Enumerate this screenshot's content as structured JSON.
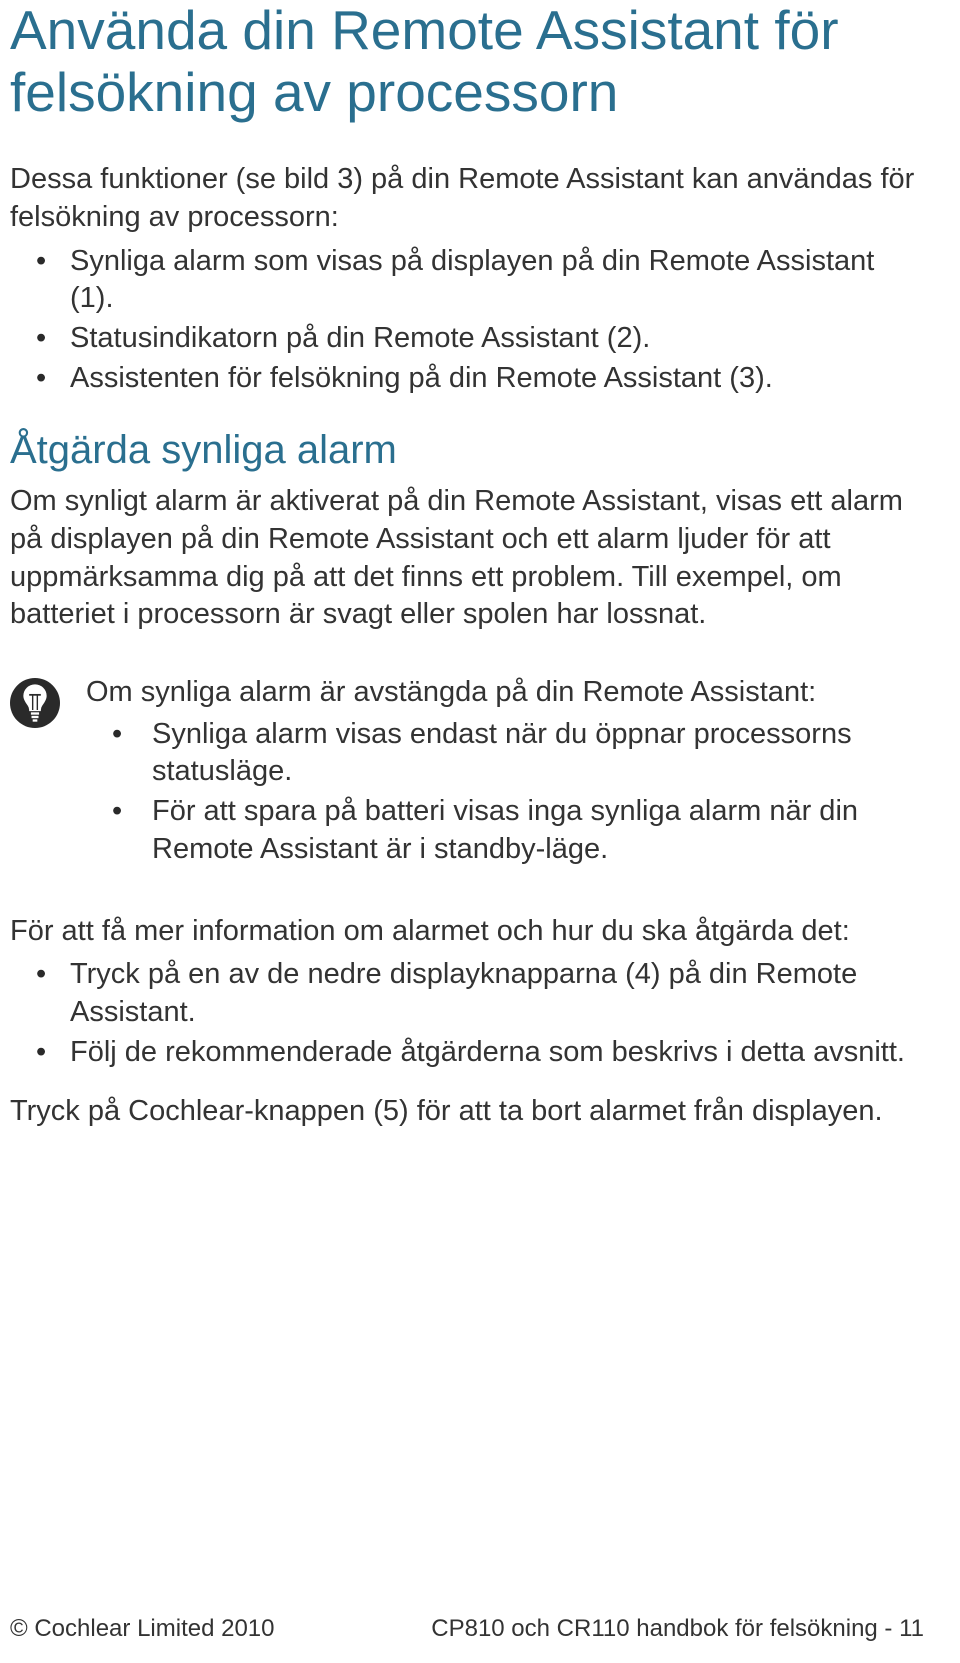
{
  "title": "Använda din Remote Assistant för felsökning av processorn",
  "intro": "Dessa funktioner (se bild 3) på din Remote Assistant kan användas för felsökning av processorn:",
  "intro_bullets": [
    "Synliga alarm som visas på displayen på din Remote Assistant (1).",
    "Statusindikatorn på din Remote Assistant (2).",
    "Assistenten för felsökning på din Remote Assistant (3)."
  ],
  "sub1_title": "Åtgärda synliga alarm",
  "sub1_para": "Om synligt alarm är aktiverat på din Remote Assistant, visas ett alarm på displayen på din Remote Assistant och ett alarm ljuder för att uppmärksamma dig på att det finns ett problem. Till exempel, om batteriet i processorn är svagt eller spolen har lossnat.",
  "tip_lead": "Om synliga alarm är avstängda på din Remote Assistant:",
  "tip_bullets": [
    "Synliga alarm visas endast när du öppnar processorns statusläge.",
    "För att spara på batteri visas inga synliga alarm när din Remote Assistant är i standby-läge."
  ],
  "after_tip_lead": "För att få mer information om alarmet och hur du ska åtgärda det:",
  "after_tip_bullets": [
    "Tryck på en av de nedre displayknapparna (4) på din Remote Assistant.",
    "Följ de rekommenderade åtgärderna som beskrivs i detta avsnitt."
  ],
  "closing": "Tryck på Cochlear-knappen (5) för att ta bort alarmet från displayen.",
  "footer_left": "© Cochlear Limited 2010",
  "footer_right": "CP810 och CR110 handbok för felsökning - 11"
}
